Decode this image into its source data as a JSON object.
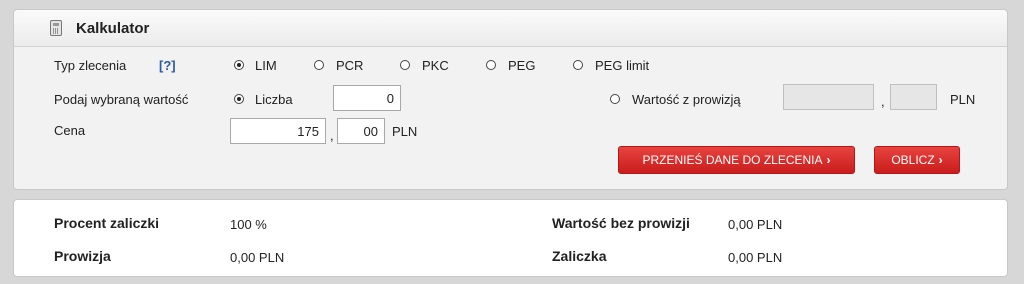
{
  "header": {
    "title": "Kalkulator"
  },
  "form": {
    "order_type_label": "Typ zlecenia",
    "help_label": "[?]",
    "order_types": [
      {
        "label": "LIM",
        "checked": true
      },
      {
        "label": "PCR",
        "checked": false
      },
      {
        "label": "PKC",
        "checked": false
      },
      {
        "label": "PEG",
        "checked": false
      },
      {
        "label": "PEG limit",
        "checked": false
      }
    ],
    "value_label": "Podaj wybraną wartość",
    "option_count_label": "Liczba",
    "count_value": "0",
    "option_commission_label": "Wartość z prowizją",
    "commission_int_value": "",
    "commission_dec_value": "",
    "separator": ",",
    "currency": "PLN",
    "price_label": "Cena",
    "price_int_value": "175",
    "price_dec_value": "00"
  },
  "buttons": {
    "transfer_label": "PRZENIEŚ DANE DO ZLECENIA",
    "calculate_label": "OBLICZ",
    "chevron": "›"
  },
  "results": {
    "advance_percent_label": "Procent zaliczki",
    "advance_percent_value": "100  %",
    "commission_label": "Prowizja",
    "commission_value": "0,00  PLN",
    "value_no_commission_label": "Wartość bez prowizji",
    "value_no_commission_value": "0,00  PLN",
    "advance_label": "Zaliczka",
    "advance_value": "0,00  PLN"
  }
}
